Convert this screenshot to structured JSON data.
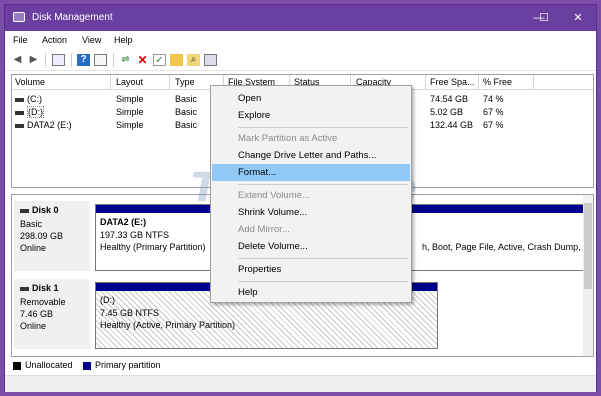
{
  "window": {
    "title": "Disk Management",
    "controls": {
      "minimize": "—",
      "maximize": "☐",
      "close": "✕"
    }
  },
  "menubar": [
    "File",
    "Action",
    "View",
    "Help"
  ],
  "toolbar_icons": [
    "back-arrow-icon",
    "forward-arrow-icon",
    "show-hide-console-icon",
    "help-icon",
    "properties-icon",
    "connect-icon",
    "delete-icon",
    "check-icon",
    "folder-icon",
    "search-icon",
    "settings-icon"
  ],
  "volume_list": {
    "columns": [
      "Volume",
      "Layout",
      "Type",
      "File System",
      "Status",
      "Capacity",
      "Free Spa...",
      "% Free"
    ],
    "rows": [
      {
        "volume": "(C:)",
        "layout": "Simple",
        "type": "Basic",
        "free": "74.54 GB",
        "pct": "74 %"
      },
      {
        "volume": "(D:)",
        "layout": "Simple",
        "type": "Basic",
        "free": "5.02 GB",
        "pct": "67 %"
      },
      {
        "volume": "DATA2 (E:)",
        "layout": "Simple",
        "type": "Basic",
        "free": "132.44 GB",
        "pct": "67 %"
      }
    ]
  },
  "disks": [
    {
      "name": "Disk 0",
      "kind": "Basic",
      "size": "298.09 GB",
      "state": "Online",
      "partition": {
        "name": "DATA2  (E:)",
        "fs": "197.33 GB NTFS",
        "status": "Healthy (Primary Partition)",
        "overflow_status": "h, Boot, Page File, Active, Crash Dump,"
      }
    },
    {
      "name": "Disk 1",
      "kind": "Removable",
      "size": "7.46 GB",
      "state": "Online",
      "partition": {
        "name": "(D:)",
        "fs": "7.45 GB NTFS",
        "status": "Healthy (Active, Primary Partition)"
      }
    }
  ],
  "legend": [
    {
      "label": "Unallocated",
      "color": "#000000"
    },
    {
      "label": "Primary partition",
      "color": "#00008b"
    }
  ],
  "context_menu": {
    "items": [
      {
        "label": "Open",
        "enabled": true
      },
      {
        "label": "Explore",
        "enabled": true
      },
      {
        "label": "Mark Partition as Active",
        "enabled": false
      },
      {
        "label": "Change Drive Letter and Paths...",
        "enabled": true
      },
      {
        "label": "Format...",
        "enabled": true,
        "highlighted": true
      },
      {
        "label": "Extend Volume...",
        "enabled": false
      },
      {
        "label": "Shrink Volume...",
        "enabled": true
      },
      {
        "label": "Add Mirror...",
        "enabled": false
      },
      {
        "label": "Delete Volume...",
        "enabled": true
      },
      {
        "label": "Properties",
        "enabled": true
      },
      {
        "label": "Help",
        "enabled": true
      }
    ]
  },
  "watermark": "TipsMake",
  "colors": {
    "titlebar": "#6b3fa0",
    "primary_partition": "#00008b",
    "menu_highlight": "#91c9f7"
  }
}
